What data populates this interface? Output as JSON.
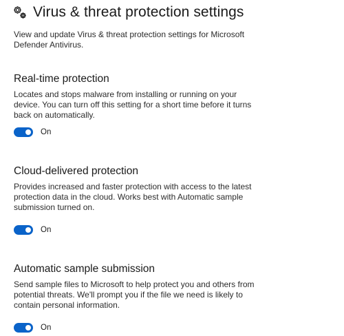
{
  "header": {
    "title": "Virus & threat protection settings",
    "icon": "gear-icon",
    "description": "View and update Virus & threat protection settings for Microsoft Defender Antivirus."
  },
  "colors": {
    "accent": "#0a63c9"
  },
  "sections": [
    {
      "title": "Real-time protection",
      "description": "Locates and stops malware from installing or running on your device. You can turn off this setting for a short time before it turns back on automatically.",
      "toggle_state": "On",
      "enabled": true
    },
    {
      "title": "Cloud-delivered protection",
      "description": "Provides increased and faster protection with access to the latest protection data in the cloud. Works best with Automatic sample submission turned on.",
      "toggle_state": "On",
      "enabled": true
    },
    {
      "title": "Automatic sample submission",
      "description": "Send sample files to Microsoft to help protect you and others from potential threats. We'll prompt you if the file we need is likely to contain personal information.",
      "toggle_state": "On",
      "enabled": true
    }
  ]
}
